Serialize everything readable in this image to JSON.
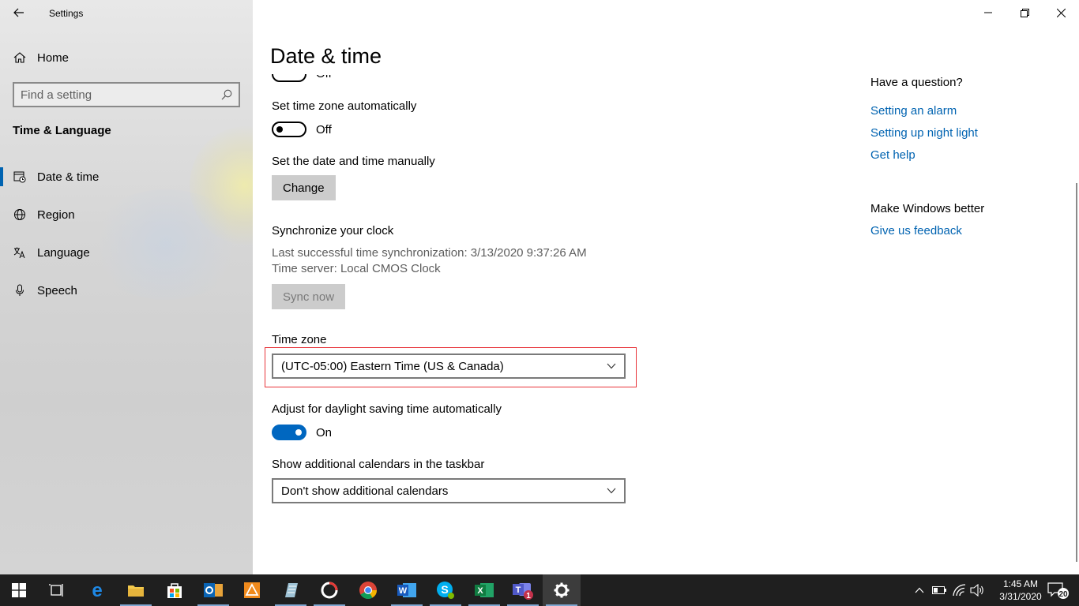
{
  "window": {
    "app_title": "Settings",
    "page_title": "Date & time"
  },
  "sidebar": {
    "home_label": "Home",
    "search_placeholder": "Find a setting",
    "section_label": "Time & Language",
    "items": [
      {
        "label": "Date & time",
        "icon": "clock-calendar-icon",
        "active": true
      },
      {
        "label": "Region",
        "icon": "globe-icon",
        "active": false
      },
      {
        "label": "Language",
        "icon": "language-icon",
        "active": false
      },
      {
        "label": "Speech",
        "icon": "microphone-icon",
        "active": false
      }
    ]
  },
  "main": {
    "partial_toggle_state": "Off",
    "set_tz_auto": {
      "label": "Set time zone automatically",
      "state": "Off"
    },
    "set_manual": {
      "label": "Set the date and time manually",
      "button": "Change"
    },
    "sync": {
      "label": "Synchronize your clock",
      "last_sync": "Last successful time synchronization: 3/13/2020 9:37:26 AM",
      "server": "Time server: Local CMOS Clock",
      "button": "Sync now"
    },
    "timezone": {
      "label": "Time zone",
      "value": "(UTC-05:00) Eastern Time (US & Canada)"
    },
    "dst": {
      "label": "Adjust for daylight saving time automatically",
      "state": "On"
    },
    "calendars": {
      "label": "Show additional calendars in the taskbar",
      "value": "Don't show additional calendars"
    }
  },
  "help": {
    "question_heading": "Have a question?",
    "links": [
      "Setting an alarm",
      "Setting up night light",
      "Get help"
    ],
    "feedback_heading": "Make Windows better",
    "feedback_link": "Give us feedback"
  },
  "taskbar": {
    "time": "1:45 AM",
    "date": "3/31/2020",
    "notification_count": "20",
    "teams_badge": "1"
  },
  "colors": {
    "accent": "#0067c0",
    "link": "#0063b1",
    "highlight_border": "#e8353b",
    "taskbar": "#1f1f1f"
  }
}
